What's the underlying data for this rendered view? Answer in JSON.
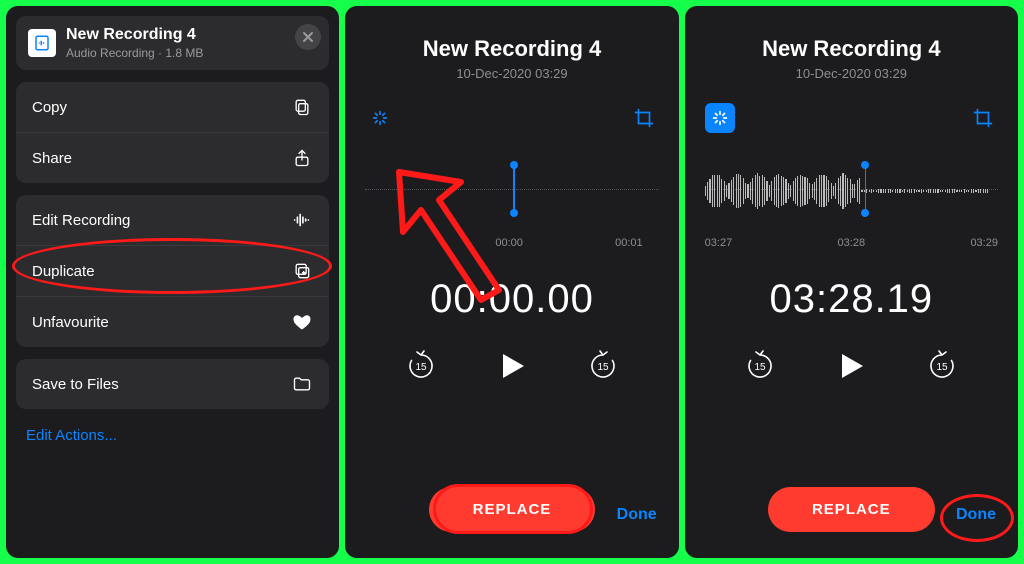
{
  "panel1": {
    "file_title": "New Recording 4",
    "file_subtitle": "Audio Recording · 1.8 MB",
    "menu": {
      "copy": "Copy",
      "share": "Share",
      "edit_recording": "Edit Recording",
      "duplicate": "Duplicate",
      "unfavourite": "Unfavourite",
      "save_to_files": "Save to Files"
    },
    "edit_actions": "Edit Actions..."
  },
  "panel2": {
    "title": "New Recording 4",
    "date": "10-Dec-2020  03:29",
    "ticks": [
      "00:00",
      "00:01"
    ],
    "big_time": "00:00.00",
    "skip_seconds": "15",
    "replace": "REPLACE",
    "done": "Done"
  },
  "panel3": {
    "title": "New Recording 4",
    "date": "10-Dec-2020  03:29",
    "ticks": [
      "03:27",
      "03:28",
      "03:29"
    ],
    "big_time": "03:28.19",
    "skip_seconds": "15",
    "replace": "REPLACE",
    "done": "Done"
  },
  "colors": {
    "accent": "#0a84ff",
    "danger": "#ff3b30"
  }
}
